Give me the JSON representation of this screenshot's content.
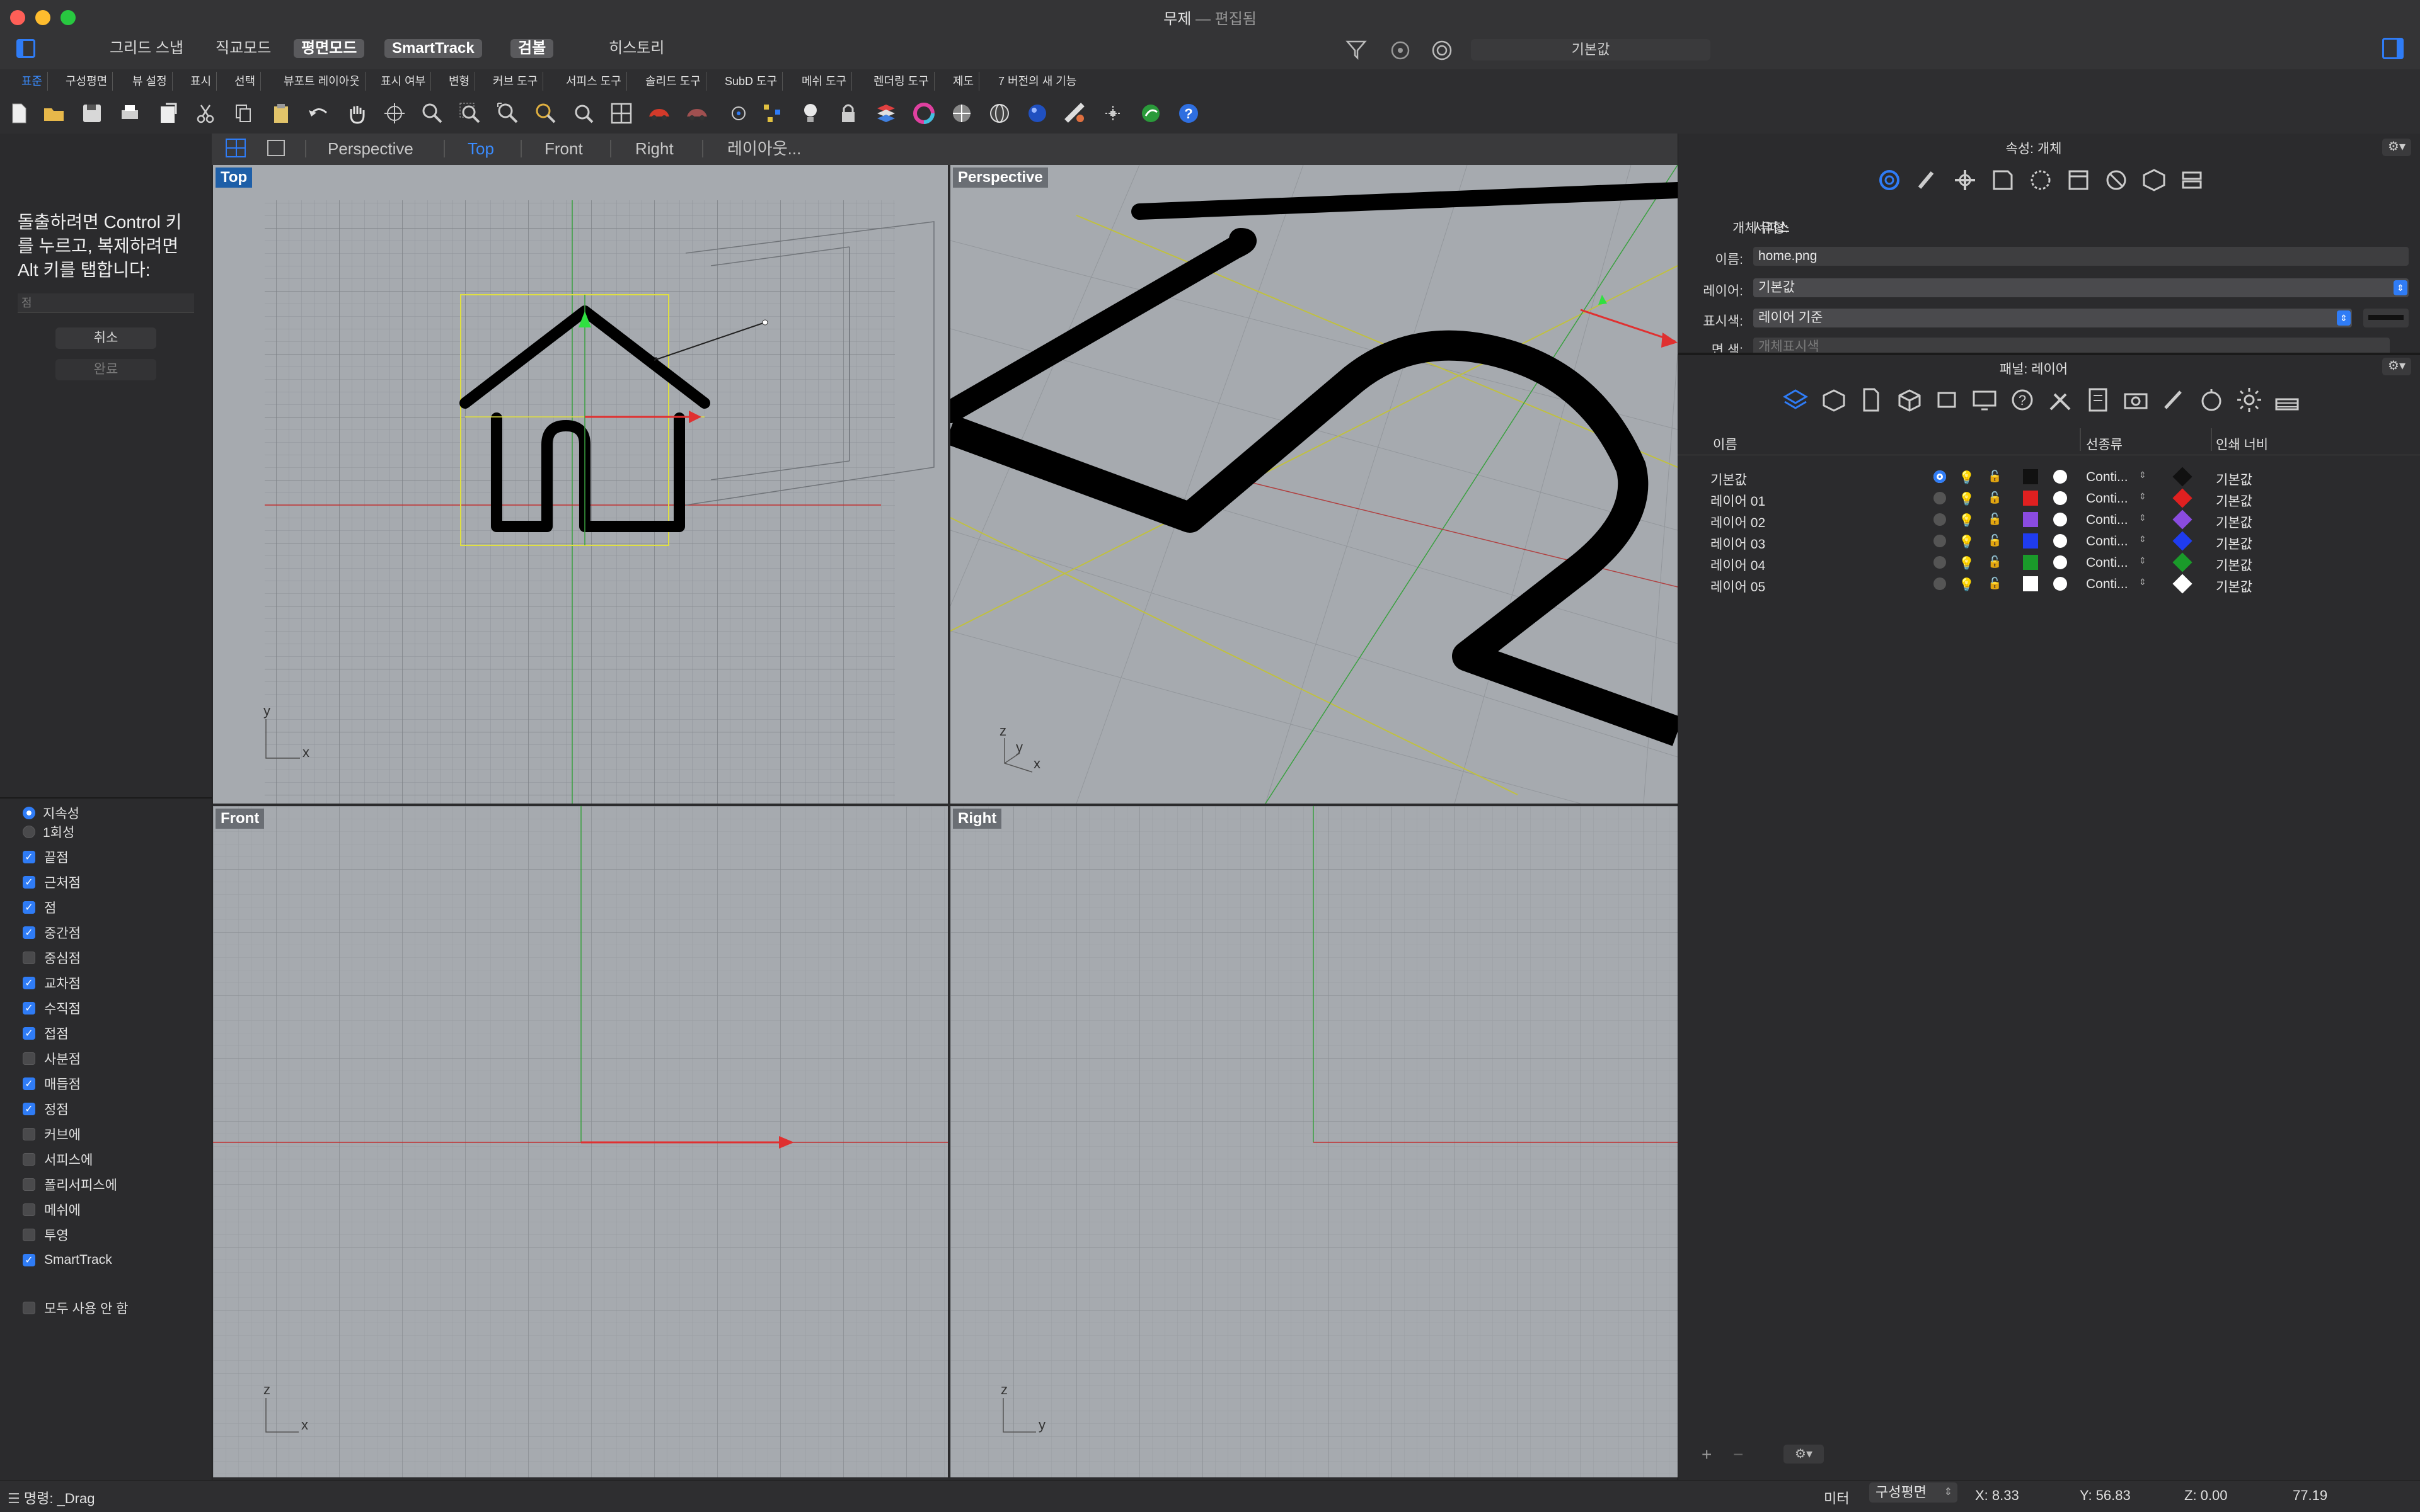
{
  "window": {
    "title": "무제",
    "subtitle": "— 편집됨",
    "search_value": "기본값"
  },
  "modes": [
    "그리드 스냅",
    "직교모드",
    "평면모드",
    "SmartTrack",
    "검볼",
    "히스토리"
  ],
  "tabs": [
    "표준",
    "구성평면",
    "뷰 설정",
    "표시",
    "선택",
    "뷰포트 레이아웃",
    "표시 여부",
    "변형",
    "커브 도구",
    "서피스 도구",
    "솔리드 도구",
    "SubD 도구",
    "메쉬 도구",
    "렌더링 도구",
    "제도",
    "7 버전의 새 기능"
  ],
  "command_prompt": {
    "message": "돌출하려면 Control 키를 누르고, 복제하려면 Alt 키를 탭합니다:",
    "input_placeholder": "점",
    "cancel_label": "취소",
    "done_label": "완료"
  },
  "osnap": {
    "persistent_label": "지속성",
    "once_label": "1회성",
    "items": [
      {
        "label": "끝점",
        "checked": true
      },
      {
        "label": "근처점",
        "checked": true
      },
      {
        "label": "점",
        "checked": true
      },
      {
        "label": "중간점",
        "checked": true
      },
      {
        "label": "중심점",
        "checked": false
      },
      {
        "label": "교차점",
        "checked": true
      },
      {
        "label": "수직점",
        "checked": true
      },
      {
        "label": "접점",
        "checked": true
      },
      {
        "label": "사분점",
        "checked": false
      },
      {
        "label": "매듭점",
        "checked": true
      },
      {
        "label": "정점",
        "checked": true
      },
      {
        "label": "커브에",
        "checked": false
      },
      {
        "label": "서피스에",
        "checked": false
      },
      {
        "label": "폴리서피스에",
        "checked": false
      },
      {
        "label": "메쉬에",
        "checked": false
      },
      {
        "label": "투영",
        "checked": false
      },
      {
        "label": "SmartTrack",
        "checked": true
      }
    ],
    "disable_all_label": "모두 사용 안 함"
  },
  "viewport_tabs": [
    "Perspective",
    "Top",
    "Front",
    "Right",
    "레이아웃..."
  ],
  "viewports": {
    "top": "Top",
    "perspective": "Perspective",
    "front": "Front",
    "right": "Right"
  },
  "axes": {
    "x": "x",
    "y": "y",
    "z": "z"
  },
  "properties": {
    "header": "속성: 개체",
    "type_label": "개체 유형:",
    "type_value": "서피스",
    "name_label": "이름:",
    "name_value": "home.png",
    "layer_label": "레이어:",
    "layer_value": "기본값",
    "display_color_label": "표시색:",
    "display_color_value": "레이어 기준",
    "face_label": "면 색:",
    "face_value": "개체표시색"
  },
  "layers_panel": {
    "header": "패널: 레이어",
    "col_name": "이름",
    "col_linetype": "선종류",
    "col_print_width": "인쇄 너비",
    "rows": [
      {
        "name": "기본값",
        "current": true,
        "color": "#111111",
        "linetype": "Conti...",
        "print_color": "#111111",
        "print_width": "기본값"
      },
      {
        "name": "레이어 01",
        "current": false,
        "color": "#e02020",
        "linetype": "Conti...",
        "print_color": "#e02020",
        "print_width": "기본값"
      },
      {
        "name": "레이어 02",
        "current": false,
        "color": "#8a4be0",
        "linetype": "Conti...",
        "print_color": "#8a4be0",
        "print_width": "기본값"
      },
      {
        "name": "레이어 03",
        "current": false,
        "color": "#1f3cf0",
        "linetype": "Conti...",
        "print_color": "#1f3cf0",
        "print_width": "기본값"
      },
      {
        "name": "레이어 04",
        "current": false,
        "color": "#1a9a2a",
        "linetype": "Conti...",
        "print_color": "#1a9a2a",
        "print_width": "기본값"
      },
      {
        "name": "레이어 05",
        "current": false,
        "color": "#ffffff",
        "linetype": "Conti...",
        "print_color": "#ffffff",
        "print_width": "기본값"
      }
    ]
  },
  "status": {
    "command": "명령: _Drag",
    "units": "미터",
    "cplane": "구성평면",
    "x": "X: 8.33",
    "y": "Y: 56.83",
    "z": "Z: 0.00",
    "value": "77.19"
  }
}
